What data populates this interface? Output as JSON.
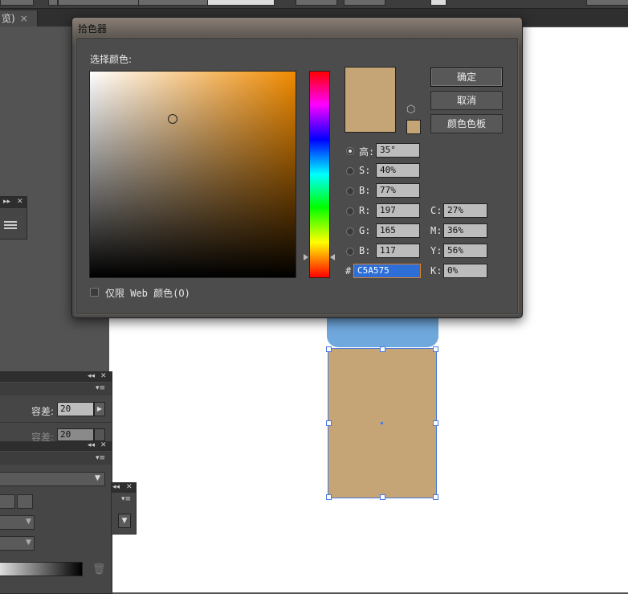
{
  "doc_tab": {
    "label": "览)",
    "close": "×"
  },
  "dialog": {
    "title": "拾色器",
    "select_label": "选择颜色:",
    "buttons": {
      "ok": "确定",
      "cancel": "取消",
      "swatches": "颜色色板"
    },
    "hsb": [
      {
        "label": "高:",
        "value": "35°",
        "selected": true
      },
      {
        "label": "S:",
        "value": "40%",
        "selected": false
      },
      {
        "label": "B:",
        "value": "77%",
        "selected": false
      }
    ],
    "rgb": [
      {
        "label": "R:",
        "value": "197"
      },
      {
        "label": "G:",
        "value": "165"
      },
      {
        "label": "B:",
        "value": "117"
      }
    ],
    "cmyk": [
      {
        "label": "C:",
        "value": "27%"
      },
      {
        "label": "M:",
        "value": "36%"
      },
      {
        "label": "Y:",
        "value": "56%"
      },
      {
        "label": "K:",
        "value": "0%"
      }
    ],
    "hex_prefix": "#",
    "hex_value": "C5A575",
    "web_only_label": "仅限 Web 颜色(O)",
    "current_color": "#c5a575"
  },
  "panels": {
    "tolerance_label": "容差:",
    "tolerance_value": "20",
    "tolerance_label_2": "容差:",
    "tolerance_value_2": "20"
  },
  "colors": {
    "fill_color": "#c5a575",
    "blue_shape": "#6fa8dc",
    "selection": "#4a78e0"
  }
}
